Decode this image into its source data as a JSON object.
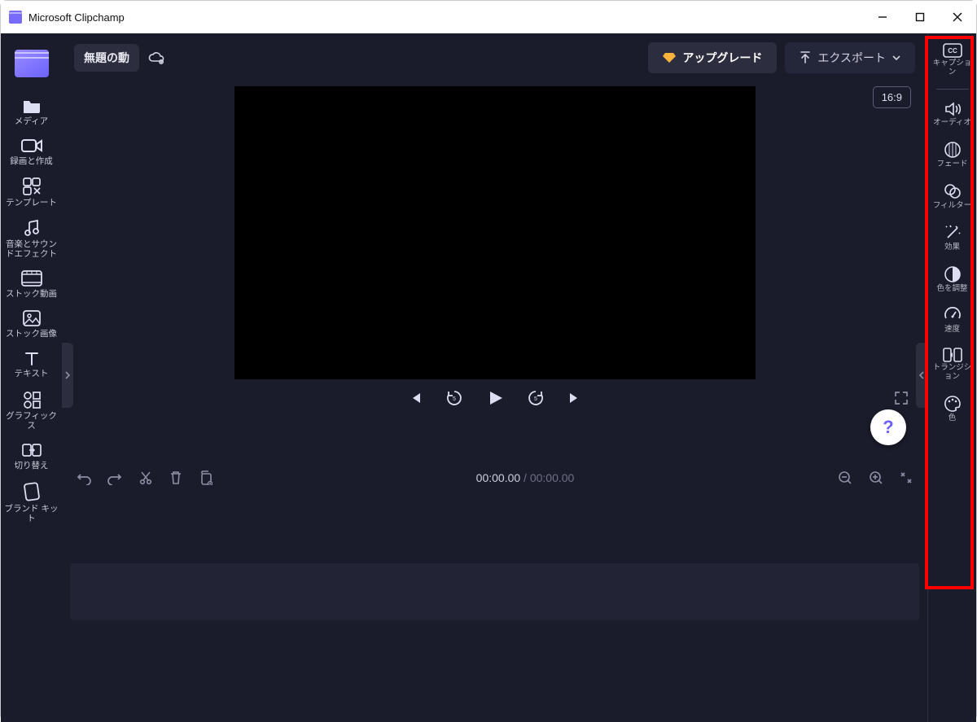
{
  "window": {
    "title": "Microsoft Clipchamp"
  },
  "header": {
    "project_title": "無題の動",
    "upgrade_label": "アップグレード",
    "export_label": "エクスポート"
  },
  "preview": {
    "aspect_ratio": "16:9",
    "current_time": "00:00.00",
    "total_time": "00:00.00"
  },
  "left_sidebar": {
    "items": [
      {
        "name": "media",
        "label": "メディア"
      },
      {
        "name": "record",
        "label": "録画と作成"
      },
      {
        "name": "template",
        "label": "テンプレート"
      },
      {
        "name": "music",
        "label": "音楽とサウンドエフェクト"
      },
      {
        "name": "stock-video",
        "label": "ストック動画"
      },
      {
        "name": "stock-image",
        "label": "ストック画像"
      },
      {
        "name": "text",
        "label": "テキスト"
      },
      {
        "name": "graphics",
        "label": "グラフィックス"
      },
      {
        "name": "transitions",
        "label": "切り替え"
      },
      {
        "name": "brand-kit",
        "label": "ブランド キット"
      }
    ]
  },
  "right_sidebar": {
    "items": [
      {
        "name": "captions",
        "label": "キャプション"
      },
      {
        "name": "audio",
        "label": "オーディオ"
      },
      {
        "name": "fade",
        "label": "フェード"
      },
      {
        "name": "filter",
        "label": "フィルター"
      },
      {
        "name": "effects",
        "label": "効果"
      },
      {
        "name": "color-adjust",
        "label": "色を調整"
      },
      {
        "name": "speed",
        "label": "速度"
      },
      {
        "name": "transition",
        "label": "トランジション"
      },
      {
        "name": "color",
        "label": "色"
      }
    ]
  },
  "help": {
    "label": "?"
  }
}
